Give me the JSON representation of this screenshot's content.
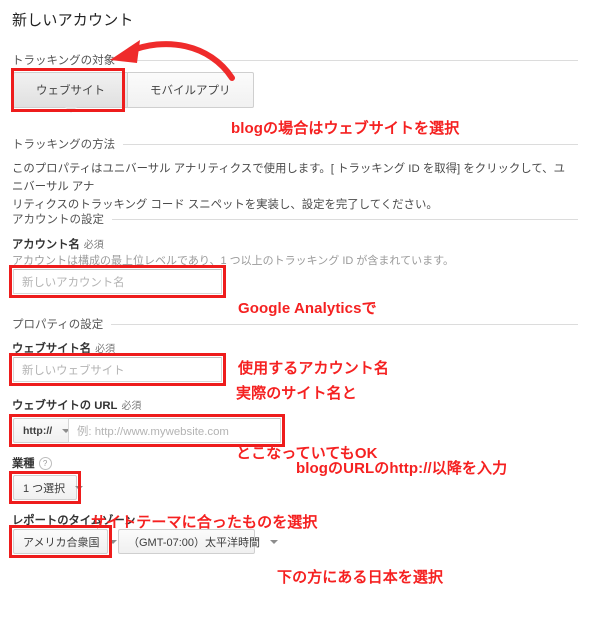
{
  "page": {
    "title": "新しいアカウント"
  },
  "sections": {
    "tracking_target": {
      "heading": "トラッキングの対象",
      "tabs": [
        {
          "label": "ウェブサイト",
          "selected": true
        },
        {
          "label": "モバイルアプリ",
          "selected": false
        }
      ]
    },
    "tracking_method": {
      "heading": "トラッキングの方法",
      "paragraph_line1": "このプロパティはユニバーサル アナリティクスで使用します。[ トラッキング ID を取得] をクリックして、ユニバーサル アナ",
      "paragraph_line2": "リティクスのトラッキング コード スニペットを実装し、設定を完了してください。"
    },
    "account_settings": {
      "heading": "アカウントの設定",
      "account_name_label": "アカウント名",
      "account_name_required": "必須",
      "account_name_hint": "アカウントは構成の最上位レベルであり、1 つ以上のトラッキング ID が含まれています。",
      "account_name_placeholder": "新しいアカウント名",
      "account_name_value": ""
    },
    "property_settings": {
      "heading": "プロパティの設定",
      "site_name_label": "ウェブサイト名",
      "site_name_required": "必須",
      "site_name_placeholder": "新しいウェブサイト",
      "site_name_value": "",
      "site_url_label": "ウェブサイトの URL",
      "site_url_required": "必須",
      "site_url_protocol": "http://",
      "site_url_placeholder": "例: http://www.mywebsite.com",
      "site_url_value": "",
      "industry_label": "業種",
      "industry_help_glyph": "?",
      "industry_value": "1 つ選択",
      "timezone_label": "レポートのタイムゾーン",
      "timezone_country_value": "アメリカ合衆国",
      "timezone_zone_value": "（GMT-07:00）太平洋時間"
    }
  },
  "annotations": [
    {
      "id": "annot-website-tab",
      "line1": "blogの場合はウェブサイトを選択"
    },
    {
      "id": "annot-account-name",
      "line1": "Google Analyticsで",
      "line2": "使用するアカウント名"
    },
    {
      "id": "annot-site-name",
      "line1": "実際のサイト名と",
      "line2": "とこなっていてもOK"
    },
    {
      "id": "annot-site-url",
      "line1": "blogのURLのhttp://以降を入力"
    },
    {
      "id": "annot-industry",
      "line1": "サイトテーマに合ったものを選択"
    },
    {
      "id": "annot-timezone",
      "line1": "下の方にある日本を選択"
    }
  ],
  "colors": {
    "annotation_red": "#f52121",
    "highlight_box_red": "#ee1c1c",
    "arrow_red": "#ef2b2b",
    "text_primary": "#333333",
    "text_muted": "#9b9b9b",
    "rule": "#dcdcdc"
  }
}
